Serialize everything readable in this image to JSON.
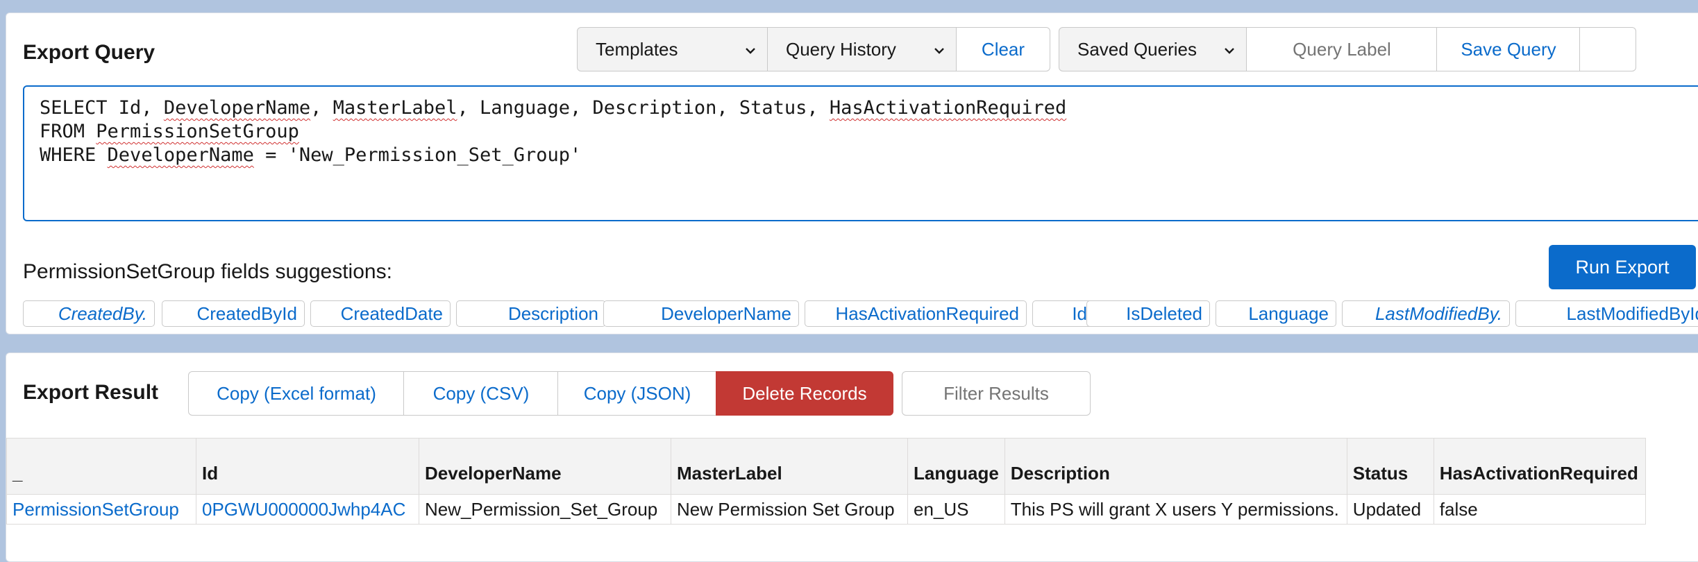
{
  "query_section": {
    "title": "Export Query",
    "templates_label": "Templates",
    "history_label": "Query History",
    "clear_label": "Clear",
    "saved_label": "Saved Queries",
    "label_placeholder": "Query Label",
    "save_label": "Save Query",
    "query_lines": [
      [
        "SELECT Id, ",
        {
          "t": "DeveloperName",
          "sq": true
        },
        ", ",
        {
          "t": "MasterLabel",
          "sq": true
        },
        ", Language, Description, Status, ",
        {
          "t": "HasActivationRequired",
          "sq": true
        }
      ],
      [
        "FROM ",
        {
          "t": "PermissionSetGroup",
          "sq": true
        }
      ],
      [
        "WHERE ",
        {
          "t": "DeveloperName",
          "sq": true
        },
        " = 'New_Permission_Set_Group'"
      ]
    ],
    "suggestions_label": "PermissionSetGroup fields suggestions:",
    "run_label": "Run Export",
    "suggestions": [
      {
        "label": "CreatedBy.",
        "relation": true
      },
      {
        "label": "CreatedById",
        "relation": false
      },
      {
        "label": "CreatedDate",
        "relation": false
      },
      {
        "label": "Description",
        "relation": false
      },
      {
        "label": "DeveloperName",
        "relation": false
      },
      {
        "label": "HasActivationRequired",
        "relation": false
      },
      {
        "label": "Id",
        "relation": false
      },
      {
        "label": "IsDeleted",
        "relation": false
      },
      {
        "label": "Language",
        "relation": false
      },
      {
        "label": "LastModifiedBy.",
        "relation": true
      },
      {
        "label": "LastModifiedById",
        "relation": false
      }
    ]
  },
  "result_section": {
    "title": "Export Result",
    "copy_excel_label": "Copy (Excel format)",
    "copy_csv_label": "Copy (CSV)",
    "copy_json_label": "Copy (JSON)",
    "delete_label": "Delete Records",
    "filter_placeholder": "Filter Results",
    "columns": [
      "_",
      "Id",
      "DeveloperName",
      "MasterLabel",
      "Language",
      "Description",
      "Status",
      "HasActivationRequired"
    ],
    "rows": [
      [
        "PermissionSetGroup",
        "0PGWU000000Jwhp4AC",
        "New_Permission_Set_Group",
        "New Permission Set Group",
        "en_US",
        "This PS will grant X users Y permissions.",
        "Updated",
        "false"
      ]
    ]
  },
  "colors": {
    "brand": "#0b6bcb",
    "danger": "#c23934",
    "page_bg": "#b0c4df"
  }
}
